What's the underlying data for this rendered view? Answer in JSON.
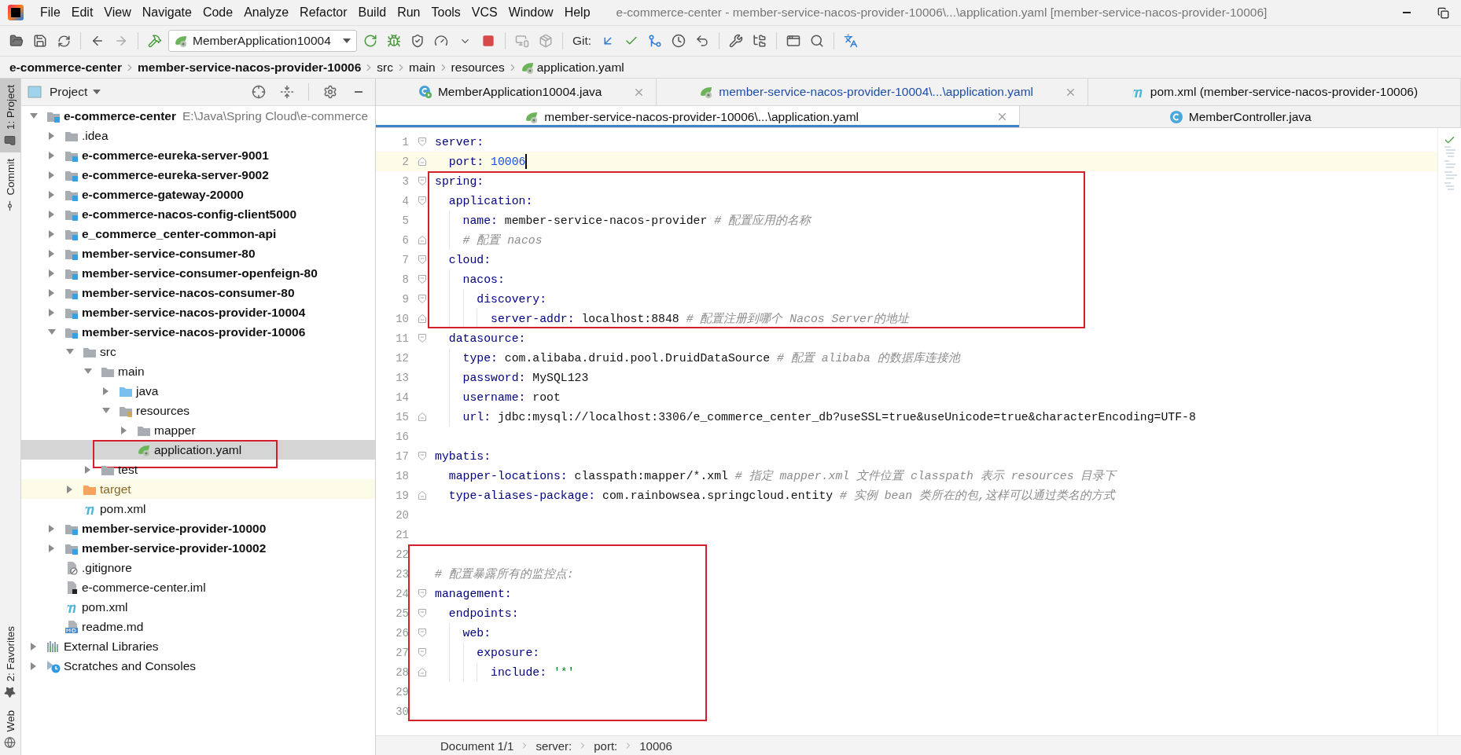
{
  "window": {
    "title": "e-commerce-center - member-service-nacos-provider-10006\\...\\application.yaml [member-service-nacos-provider-10006]"
  },
  "menu": [
    "File",
    "Edit",
    "View",
    "Navigate",
    "Code",
    "Analyze",
    "Refactor",
    "Build",
    "Run",
    "Tools",
    "VCS",
    "Window",
    "Help"
  ],
  "toolbar": {
    "run_config": "MemberApplication10004",
    "git_label": "Git:"
  },
  "nav_bar": [
    {
      "label": "e-commerce-center",
      "kind": "module",
      "bold": true
    },
    {
      "label": "member-service-nacos-provider-10006",
      "kind": "module",
      "bold": true
    },
    {
      "label": "src",
      "kind": "folder",
      "bold": false
    },
    {
      "label": "main",
      "kind": "folder",
      "bold": false
    },
    {
      "label": "resources",
      "kind": "folder",
      "bold": false
    },
    {
      "label": "application.yaml",
      "kind": "yaml",
      "bold": false
    }
  ],
  "tool_strip": {
    "top": [
      {
        "label": "1: Project",
        "kind": "folder",
        "selected": true
      },
      {
        "label": "Commit",
        "kind": "commit",
        "selected": false
      }
    ],
    "bottom": [
      {
        "label": "2: Favorites",
        "kind": "star",
        "selected": false
      },
      {
        "label": "Web",
        "kind": "globe",
        "selected": false
      }
    ]
  },
  "project": {
    "title": "Project",
    "tree": [
      {
        "label": "e-commerce-center",
        "path": "E:\\Java\\Spring Cloud\\e-commerce",
        "kind": "module",
        "bold": true,
        "expanded": true,
        "selected": false,
        "children": [
          {
            "label": ".idea",
            "kind": "folder",
            "bold": false,
            "expanded": false,
            "selected": false
          },
          {
            "label": "e-commerce-eureka-server-9001",
            "kind": "module",
            "bold": true,
            "expanded": false,
            "selected": false
          },
          {
            "label": "e-commerce-eureka-server-9002",
            "kind": "module",
            "bold": true,
            "expanded": false,
            "selected": false
          },
          {
            "label": "e-commerce-gateway-20000",
            "kind": "module",
            "bold": true,
            "expanded": false,
            "selected": false
          },
          {
            "label": "e-commerce-nacos-config-client5000",
            "kind": "module",
            "bold": true,
            "expanded": false,
            "selected": false
          },
          {
            "label": "e_commerce_center-common-api",
            "kind": "module",
            "bold": true,
            "expanded": false,
            "selected": false
          },
          {
            "label": "member-service-consumer-80",
            "kind": "module",
            "bold": true,
            "expanded": false,
            "selected": false
          },
          {
            "label": "member-service-consumer-openfeign-80",
            "kind": "module",
            "bold": true,
            "expanded": false,
            "selected": false
          },
          {
            "label": "member-service-nacos-consumer-80",
            "kind": "module",
            "bold": true,
            "expanded": false,
            "selected": false
          },
          {
            "label": "member-service-nacos-provider-10004",
            "kind": "module",
            "bold": true,
            "expanded": false,
            "selected": false
          },
          {
            "label": "member-service-nacos-provider-10006",
            "kind": "module",
            "bold": true,
            "expanded": true,
            "selected": false,
            "children": [
              {
                "label": "src",
                "kind": "folder",
                "bold": false,
                "expanded": true,
                "selected": false,
                "children": [
                  {
                    "label": "main",
                    "kind": "folder",
                    "bold": false,
                    "expanded": true,
                    "selected": false,
                    "children": [
                      {
                        "label": "java",
                        "kind": "source",
                        "bold": false,
                        "expanded": false,
                        "selected": false
                      },
                      {
                        "label": "resources",
                        "kind": "resources",
                        "bold": false,
                        "expanded": true,
                        "selected": false,
                        "children": [
                          {
                            "label": "mapper",
                            "kind": "folder",
                            "bold": false,
                            "expanded": false,
                            "selected": false
                          },
                          {
                            "label": "application.yaml",
                            "kind": "yaml",
                            "bold": false,
                            "selected": true,
                            "boxed": true
                          }
                        ]
                      }
                    ]
                  },
                  {
                    "label": "test",
                    "kind": "folder",
                    "bold": false,
                    "expanded": false,
                    "selected": false
                  }
                ]
              },
              {
                "label": "target",
                "kind": "excluded",
                "bold": false,
                "expanded": false,
                "selected": false
              },
              {
                "label": "pom.xml",
                "kind": "maven",
                "bold": false,
                "selected": false
              }
            ]
          },
          {
            "label": "member-service-provider-10000",
            "kind": "module",
            "bold": true,
            "expanded": false,
            "selected": false
          },
          {
            "label": "member-service-provider-10002",
            "kind": "module",
            "bold": true,
            "expanded": false,
            "selected": false
          },
          {
            "label": ".gitignore",
            "kind": "gitignore",
            "bold": false,
            "selected": false
          },
          {
            "label": "e-commerce-center.iml",
            "kind": "iml",
            "bold": false,
            "selected": false
          },
          {
            "label": "pom.xml",
            "kind": "maven",
            "bold": false,
            "selected": false
          },
          {
            "label": "readme.md",
            "kind": "markdown",
            "bold": false,
            "selected": false
          }
        ]
      },
      {
        "label": "External Libraries",
        "kind": "libraries",
        "bold": false,
        "expanded": false,
        "selected": false
      },
      {
        "label": "Scratches and Consoles",
        "kind": "scratches",
        "bold": false,
        "expanded": false,
        "selected": false
      }
    ]
  },
  "editor": {
    "tab_rows": [
      [
        {
          "label": "MemberApplication10004.java",
          "kind": "java",
          "selected": false,
          "modified": false,
          "closable": true
        },
        {
          "label": "member-service-nacos-provider-10004\\...\\application.yaml",
          "kind": "yaml",
          "selected": false,
          "modified": true,
          "closable": true
        },
        {
          "label": "pom.xml (member-service-nacos-provider-10006)",
          "kind": "maven",
          "selected": false,
          "modified": false,
          "closable": false
        }
      ],
      [
        {
          "label": "member-service-nacos-provider-10006\\...\\application.yaml",
          "kind": "yaml",
          "selected": true,
          "modified": false,
          "closable": true
        },
        {
          "label": "MemberController.java",
          "kind": "class",
          "selected": false,
          "modified": false,
          "closable": false
        }
      ]
    ],
    "code": [
      {
        "no": "1",
        "key": "server:",
        "boxed": false,
        "children": [
          {
            "no": "2",
            "kind": "number",
            "key": "port:",
            "value": "10006",
            "boxed": false,
            "current": true
          }
        ]
      },
      {
        "no": "3",
        "key": "spring:",
        "boxed": true,
        "children": [
          {
            "no": "4",
            "key": "application:",
            "boxed": true,
            "children": [
              {
                "no": "5",
                "kind": "scalar",
                "key": "name:",
                "value": "member-service-nacos-provider",
                "comment": "# 配置应用的名称",
                "boxed": true
              },
              {
                "no": "6",
                "comment": "# 配置 nacos",
                "boxed": true
              }
            ]
          },
          {
            "no": "7",
            "key": "cloud:",
            "boxed": true,
            "children": [
              {
                "no": "8",
                "key": "nacos:",
                "boxed": true,
                "children": [
                  {
                    "no": "9",
                    "key": "discovery:",
                    "boxed": true,
                    "children": [
                      {
                        "no": "10",
                        "kind": "scalar",
                        "key": "server-addr:",
                        "value": "localhost:8848",
                        "comment": "# 配置注册到哪个 Nacos Server的地址",
                        "boxed": true
                      }
                    ]
                  }
                ]
              }
            ]
          },
          {
            "no": "11",
            "key": "datasource:",
            "boxed": false,
            "children": [
              {
                "no": "12",
                "kind": "scalar",
                "key": "type:",
                "value": "com.alibaba.druid.pool.DruidDataSource",
                "comment": "# 配置 alibaba 的数据库连接池",
                "boxed": false
              },
              {
                "no": "13",
                "kind": "scalar",
                "key": "password:",
                "value": "MySQL123",
                "boxed": false
              },
              {
                "no": "14",
                "kind": "scalar",
                "key": "username:",
                "value": "root",
                "boxed": false
              },
              {
                "no": "15",
                "kind": "scalar",
                "key": "url:",
                "value": "jdbc:mysql://localhost:3306/e_commerce_center_db?useSSL=true&useUnicode=true&characterEncoding=UTF-8",
                "boxed": false
              }
            ]
          }
        ]
      },
      {
        "no": "16",
        "boxed": false
      },
      {
        "no": "17",
        "key": "mybatis:",
        "boxed": false,
        "children": [
          {
            "no": "18",
            "kind": "scalar",
            "key": "mapper-locations:",
            "value": "classpath:mapper/*.xml",
            "comment": "# 指定 mapper.xml 文件位置 classpath 表示 resources 目录下",
            "boxed": false
          },
          {
            "no": "19",
            "kind": "scalar",
            "key": "type-aliases-package:",
            "value": "com.rainbowsea.springcloud.entity",
            "comment": "# 实例 bean 类所在的包,这样可以通过类名的方式",
            "boxed": false
          }
        ]
      },
      {
        "no": "20",
        "boxed": false
      },
      {
        "no": "21",
        "boxed": false
      },
      {
        "no": "22",
        "boxed": true
      },
      {
        "no": "23",
        "comment": "# 配置暴露所有的监控点:",
        "boxed": true
      },
      {
        "no": "24",
        "key": "management:",
        "boxed": true,
        "children": [
          {
            "no": "25",
            "key": "endpoints:",
            "boxed": true,
            "children": [
              {
                "no": "26",
                "key": "web:",
                "boxed": true,
                "children": [
                  {
                    "no": "27",
                    "key": "exposure:",
                    "boxed": true,
                    "children": [
                      {
                        "no": "28",
                        "kind": "string",
                        "key": "include:",
                        "value": "'*'",
                        "boxed": true
                      }
                    ]
                  }
                ]
              }
            ]
          }
        ]
      },
      {
        "no": "29",
        "boxed": true
      },
      {
        "no": "30",
        "boxed": true
      }
    ],
    "breadcrumbs": [
      "Document 1/1",
      "server:",
      "port:",
      "10006"
    ]
  }
}
